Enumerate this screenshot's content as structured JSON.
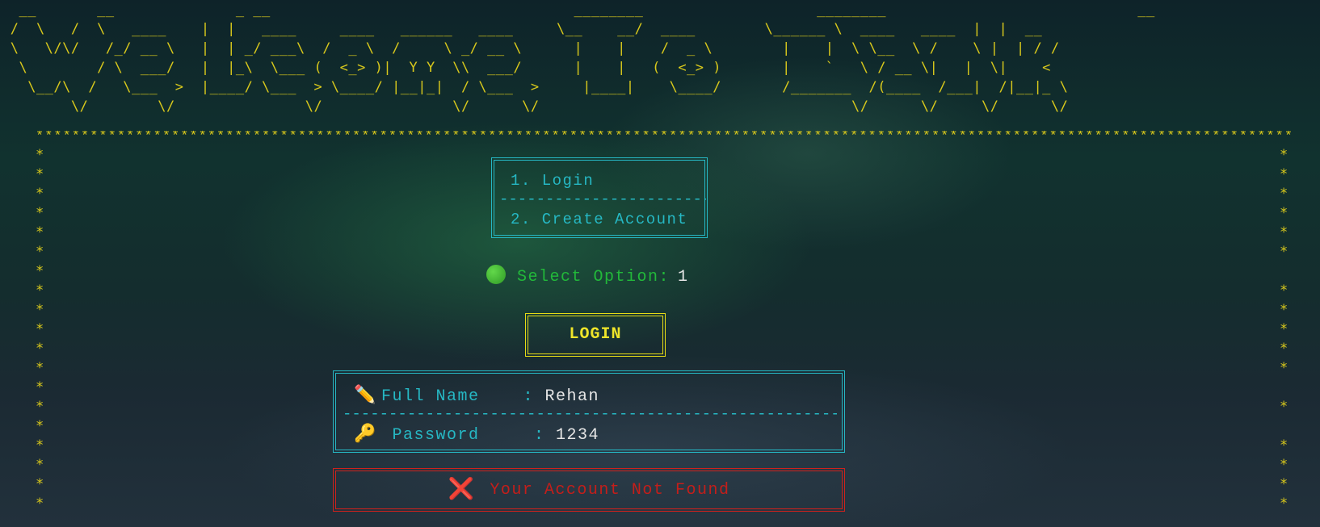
{
  "banner": {
    "art": "  __       __              _ __                                   ________                    ________                             __\n /  \\   /  \\   ____    |  |   ____     ____   ______   ____     \\__    __/  ____        \\______ \\  ____   ____  |  |  __\n \\   \\/\\/   /_/ __ \\   |  | _/ ___\\  /  _ \\  /     \\ _/ __ \\      |    |    /  _ \\        |    |  \\ \\__  \\ /    \\ |  | / /\n  \\        / \\  ___/   |  |_\\  \\___ (  <_> )|  Y Y  \\\\  ___/      |    |   (  <_> )       |    `   \\ / __ \\|   |  \\|    <\n   \\__/\\  /   \\___  >  |____/ \\___  > \\____/ |__|_|  / \\___  >     |____|    \\____/       /_______  /(____  /___|  /|__|_ \\\n        \\/        \\/               \\/               \\/      \\/                                    \\/      \\/     \\/      \\/"
  },
  "border": {
    "top": "******************************************************************************************************************************************************************",
    "left": "*\n*\n*\n*\n*\n*\n*\n*\n*\n*\n*\n*\n*\n*\n*\n*\n*\n*\n*",
    "right": "*\n*\n*\n*\n*\n*\n \n*\n*\n*\n*\n*\n \n*\n \n*\n*\n*\n*"
  },
  "menu": {
    "item1": "1. Login",
    "divider": "----------------------------------------",
    "item2": "2. Create Account"
  },
  "select": {
    "icon": "green-circle-icon",
    "label": "Select Option:",
    "value": "1"
  },
  "login_button": {
    "label": "LOGIN"
  },
  "form": {
    "name_icon": "✏️",
    "name_label": "Full Name    : ",
    "name_value": "Rehan",
    "divider": "----------------------------------------------------------------------------",
    "pass_icon": "🔑",
    "pass_label": " Password     : ",
    "pass_value": "1234"
  },
  "error": {
    "icon": "❌",
    "text": "Your Account Not Found"
  },
  "colors": {
    "ascii_yellow": "#d8c81c",
    "cyan": "#26b8c4",
    "green": "#22b83a",
    "red": "#c41e1a",
    "button_yellow": "#e6dc16"
  }
}
